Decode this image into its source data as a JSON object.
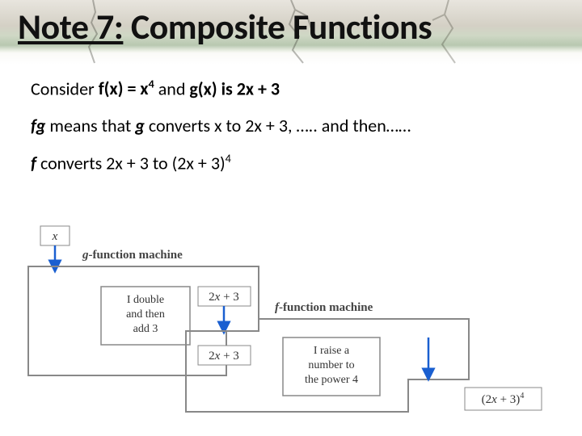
{
  "title": {
    "underlined": "Note 7:",
    "rest": "  Composite Functions"
  },
  "body": {
    "line1": {
      "pre": "Consider ",
      "f_def_a": "f(x) = x",
      "f_exp": "4",
      "mid": "  and  ",
      "g_def": "g(x) is 2x + 3"
    },
    "line2": {
      "fg": "fg",
      "a": " means that ",
      "g": "g",
      "b": " converts x to 2x + 3, ….. and then……"
    },
    "line3": {
      "f": "f",
      "a": " converts 2x + 3 to (2x + 3)",
      "exp": "4"
    }
  },
  "diagram": {
    "input": "x",
    "g_label_fn": "g",
    "g_label_rest": "-function machine",
    "g_desc1": "I double",
    "g_desc2": "and then",
    "g_desc3": "add 3",
    "mid1": "2x + 3",
    "mid2": "2x + 3",
    "f_label_fn": "f",
    "f_label_rest": "-function machine",
    "f_desc1": "I raise a",
    "f_desc2": "number to",
    "f_desc3": "the power 4",
    "output_a": "(2x + 3)",
    "output_exp": "4"
  }
}
